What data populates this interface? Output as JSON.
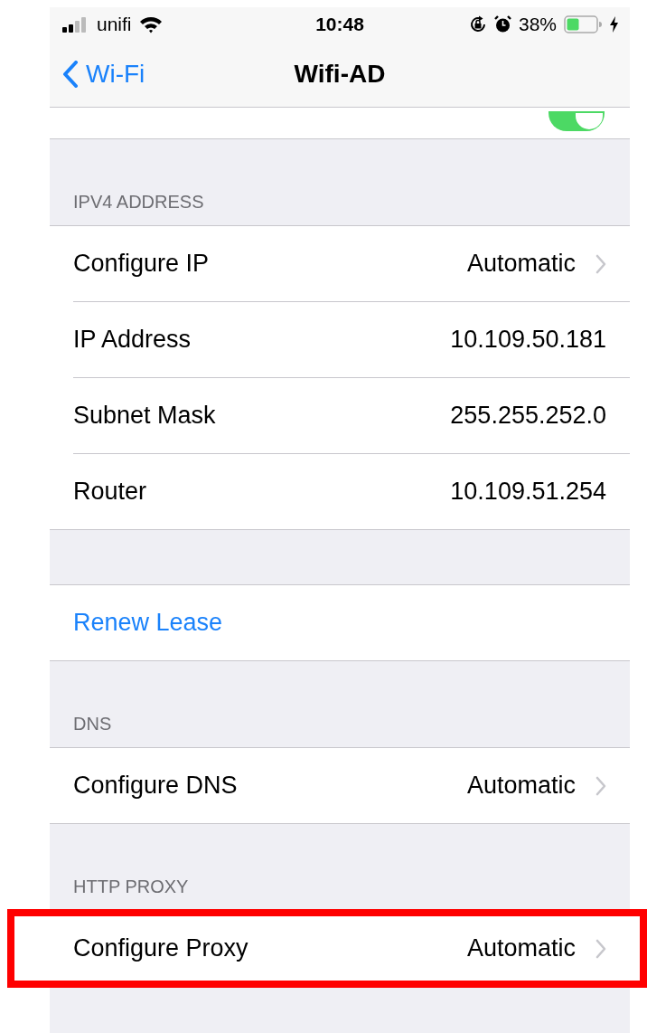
{
  "status_bar": {
    "carrier": "unifi",
    "time": "10:48",
    "battery": "38%"
  },
  "nav_bar": {
    "back": "Wi-Fi",
    "title": "Wifi-AD"
  },
  "auto_join_toggle": {
    "on": true
  },
  "sections": [
    {
      "header": "IPV4 ADDRESS",
      "rows": [
        {
          "kind": "detail",
          "label": "Configure IP",
          "value": "Automatic",
          "chevron": true,
          "highlighted": false
        },
        {
          "kind": "detail",
          "label": "IP Address",
          "value": "10.109.50.181",
          "chevron": false,
          "highlighted": false
        },
        {
          "kind": "detail",
          "label": "Subnet Mask",
          "value": "255.255.252.0",
          "chevron": false,
          "highlighted": false
        },
        {
          "kind": "detail",
          "label": "Router",
          "value": "10.109.51.254",
          "chevron": false,
          "highlighted": false
        }
      ]
    },
    {
      "rows": [
        {
          "kind": "action",
          "label": "Renew Lease",
          "highlighted": false
        }
      ]
    },
    {
      "header": "DNS",
      "rows": [
        {
          "kind": "detail",
          "label": "Configure DNS",
          "value": "Automatic",
          "chevron": true,
          "highlighted": false
        }
      ]
    },
    {
      "header": "HTTP PROXY",
      "rows": [
        {
          "kind": "detail",
          "label": "Configure Proxy",
          "value": "Automatic",
          "chevron": true,
          "highlighted": true
        }
      ]
    }
  ]
}
